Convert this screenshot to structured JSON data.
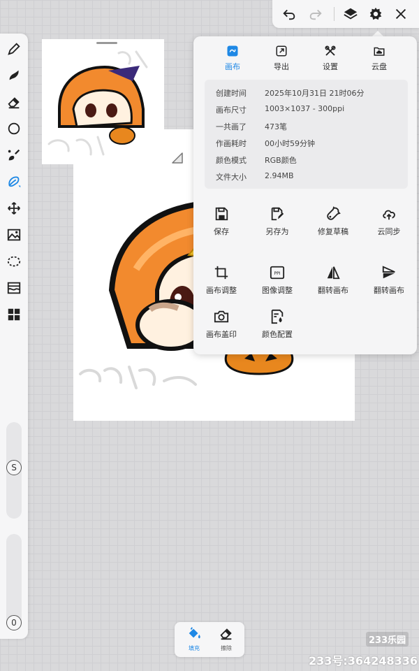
{
  "theme": {
    "accent": "#1e88e5",
    "panel_bg": "#f5f5f6",
    "grid_bg": "#d9d9db"
  },
  "left_toolbar": {
    "tools": [
      {
        "icon": "pen-icon"
      },
      {
        "icon": "smudge-icon"
      },
      {
        "icon": "eraser-icon"
      },
      {
        "icon": "circle-shape-icon"
      },
      {
        "icon": "brush-icon"
      },
      {
        "icon": "lasso-fill-icon"
      },
      {
        "icon": "move-icon"
      },
      {
        "icon": "image-import-icon"
      },
      {
        "icon": "selection-icon"
      },
      {
        "icon": "filter-icon"
      },
      {
        "icon": "grid-menu-icon"
      }
    ],
    "size_badge": "S",
    "opacity_badge": "0"
  },
  "top_toolbar": {
    "icons": [
      "undo-icon",
      "redo-icon",
      "layers-icon",
      "settings-icon",
      "close-icon"
    ]
  },
  "panel": {
    "tabs": [
      {
        "label": "画布",
        "icon": "canvas-tab-icon",
        "active": true
      },
      {
        "label": "导出",
        "icon": "export-icon",
        "active": false
      },
      {
        "label": "设置",
        "icon": "tools-settings-icon",
        "active": false
      },
      {
        "label": "云盘",
        "icon": "cloud-drive-icon",
        "active": false
      }
    ],
    "info": [
      {
        "key": "创建时间",
        "value": "2025年10月31日 21时06分"
      },
      {
        "key": "画布尺寸",
        "value": "1003×1037 - 300ppi"
      },
      {
        "key": "一共画了",
        "value": "473笔"
      },
      {
        "key": "作画耗时",
        "value": "00小时59分钟"
      },
      {
        "key": "颜色模式",
        "value": "RGB颜色"
      },
      {
        "key": "文件大小",
        "value": "2.94MB"
      }
    ],
    "actions": [
      {
        "label": "保存",
        "icon": "save-icon"
      },
      {
        "label": "另存为",
        "icon": "save-as-icon"
      },
      {
        "label": "修复草稿",
        "icon": "repair-icon"
      },
      {
        "label": "云同步",
        "icon": "cloud-sync-icon"
      },
      {
        "label": "画布调整",
        "icon": "crop-icon"
      },
      {
        "label": "图像调整",
        "icon": "ppi-icon"
      },
      {
        "label": "翻转画布",
        "icon": "flip-horizontal-icon"
      },
      {
        "label": "翻转画布",
        "icon": "flip-vertical-icon"
      },
      {
        "label": "画布盖印",
        "icon": "camera-icon"
      },
      {
        "label": "颜色配置",
        "icon": "color-profile-icon"
      }
    ]
  },
  "bottom_bar": {
    "fill_label": "填充",
    "erase_label": "擦除"
  },
  "watermark": {
    "logo": "233乐园",
    "text": "233号:364248336"
  }
}
